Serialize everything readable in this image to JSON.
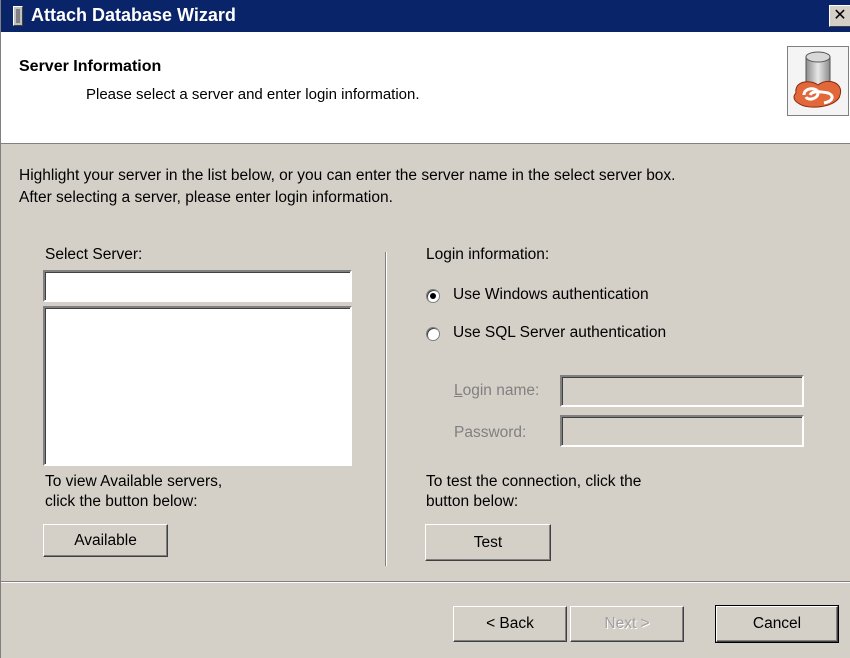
{
  "window": {
    "title": "Attach Database Wizard",
    "close_glyph": "✕"
  },
  "header": {
    "title": "Server Information",
    "subtitle": "Please select a server and enter login information.",
    "icon": "database-icon"
  },
  "intro": {
    "line1": "Highlight your server in the list below, or you can enter the server name in the select server box.",
    "line2": "After selecting a server, please enter login information."
  },
  "server": {
    "label": "Select Server:",
    "input_value": "",
    "list_items": [],
    "hint_line1": "To view Available servers,",
    "hint_line2": "click the button below:",
    "available_label": "Available"
  },
  "login": {
    "label": "Login information:",
    "auth_options": [
      {
        "label": "Use Windows authentication",
        "checked": true
      },
      {
        "label": "Use SQL Server authentication",
        "checked": false
      }
    ],
    "login_name_first": "L",
    "login_name_rest": "ogin name:",
    "password_label": "Password:",
    "login_name_value": "",
    "password_value": "",
    "hint_line1": "To test the connection, click the",
    "hint_line2": "button below:",
    "test_label": "Test"
  },
  "footer": {
    "back_label": "< Back",
    "next_label": "Next >",
    "cancel_label": "Cancel"
  }
}
